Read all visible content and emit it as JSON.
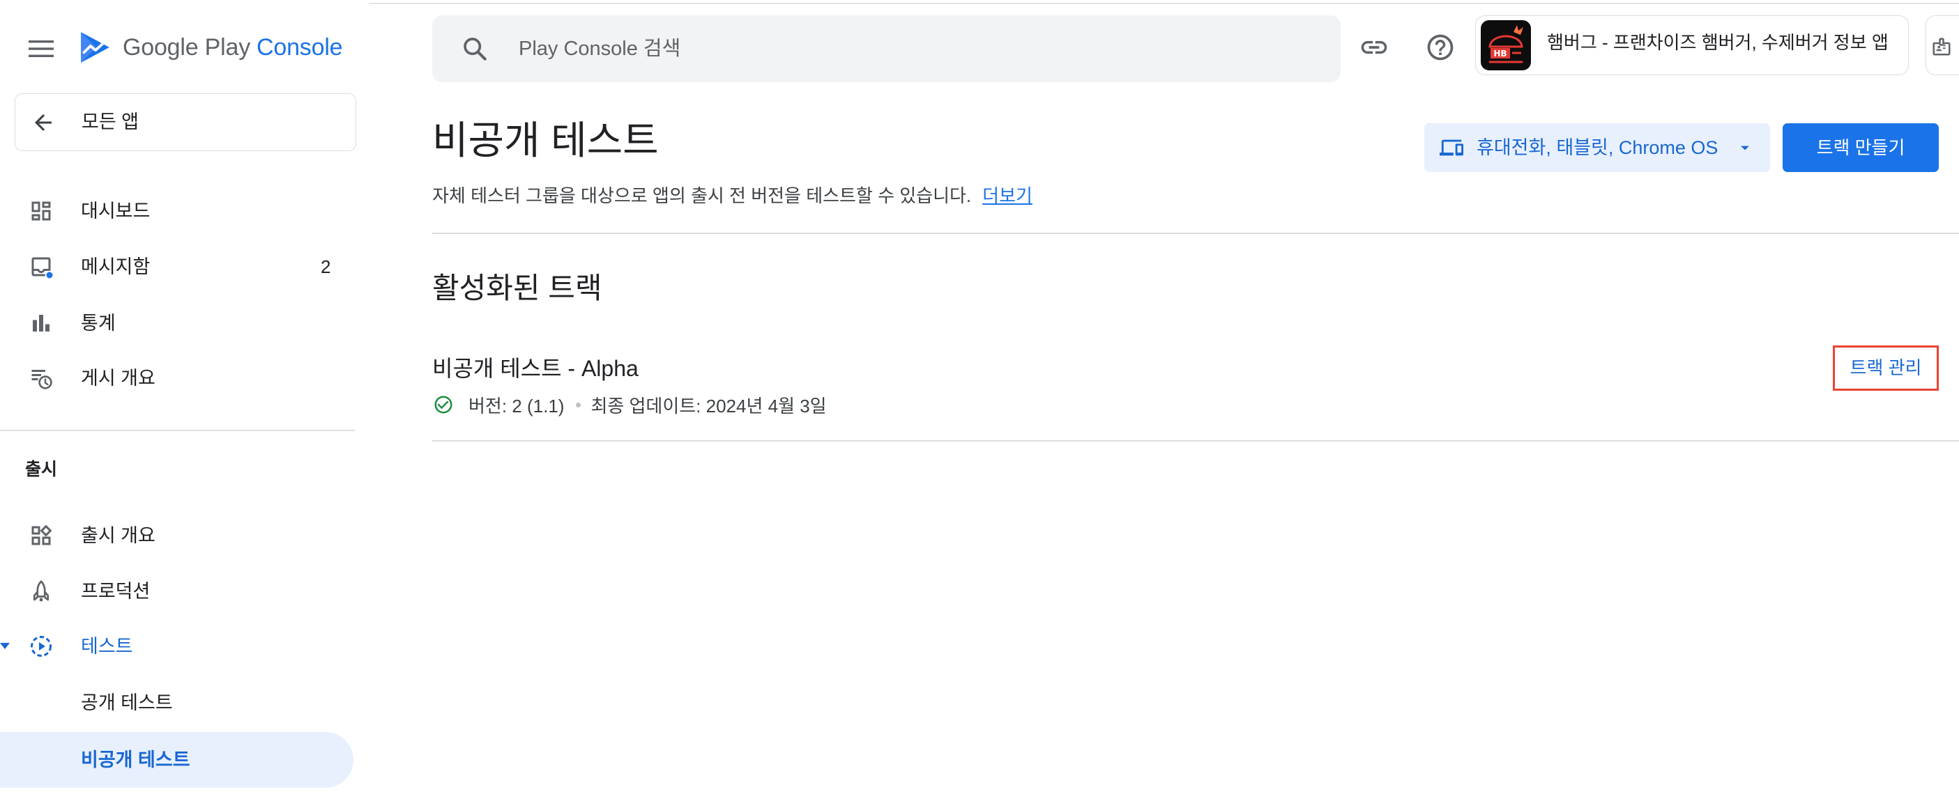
{
  "colors": {
    "accent": "#1a73e8",
    "accent_text": "#1967d2",
    "selected_background": "#e8f0fe",
    "success": "#1e8e3e",
    "highlight_box": "#ea4335",
    "text_primary": "#202124",
    "text_secondary": "#5f6368",
    "divider": "#dadce0"
  },
  "header": {
    "menu_icon": "menu-icon",
    "brand": {
      "logo_icon": "play-console-logo",
      "product": "Google Play",
      "suffix": "Console"
    },
    "search": {
      "icon": "search-icon",
      "placeholder": "Play Console 검색"
    },
    "actions": [
      {
        "icon": "link-icon"
      },
      {
        "icon": "help-icon"
      }
    ],
    "app_selector": {
      "app_icon": "hamburger-app-icon",
      "app_icon_text": "HB",
      "app_name": "햄버그 - 프랜차이즈 햄버거, 수제버거 정보 앱"
    },
    "account_icon": "badge-icon"
  },
  "sidebar": {
    "all_apps": {
      "icon": "arrow-back-icon",
      "label": "모든 앱"
    },
    "nav": [
      {
        "icon": "dashboard-icon",
        "label": "대시보드"
      },
      {
        "icon": "inbox-icon",
        "label": "메시지함",
        "badge": "2"
      },
      {
        "icon": "statistics-icon",
        "label": "통계"
      },
      {
        "icon": "publishing-overview-icon",
        "label": "게시 개요"
      }
    ],
    "release": {
      "title": "출시",
      "items": [
        {
          "icon": "release-overview-icon",
          "label": "출시 개요"
        },
        {
          "icon": "production-icon",
          "label": "프로덕션"
        },
        {
          "icon": "testing-icon",
          "label": "테스트",
          "expanded": true,
          "active": true,
          "children": [
            {
              "label": "공개 테스트",
              "selected": false
            },
            {
              "label": "비공개 테스트",
              "selected": true
            }
          ]
        }
      ]
    }
  },
  "page": {
    "title": "비공개 테스트",
    "description": "자체 테스터 그룹을 대상으로 앱의 출시 전 버전을 테스트할 수 있습니다.",
    "learn_more": "더보기",
    "device_filter": {
      "icon": "devices-icon",
      "label": "휴대전화, 태블릿, Chrome OS"
    },
    "create_track_button": "트랙 만들기",
    "active_tracks": {
      "heading": "활성화된 트랙",
      "tracks": [
        {
          "name": "비공개 테스트 - Alpha",
          "status_icon": "check-circle-icon",
          "version": "버전: 2 (1.1)",
          "last_updated": "최종 업데이트: 2024년 4월 3일",
          "manage_link": "트랙 관리",
          "manage_link_highlighted": true
        }
      ]
    }
  }
}
